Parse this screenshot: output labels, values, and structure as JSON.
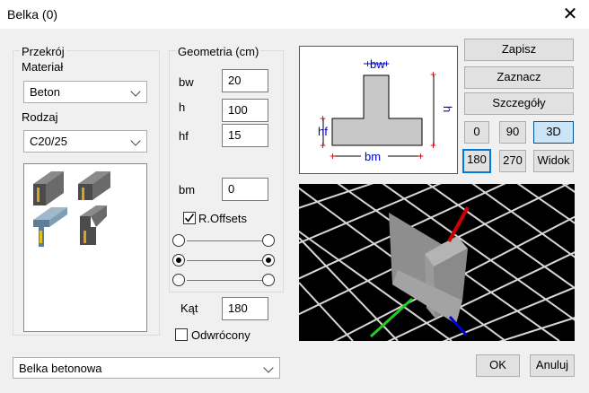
{
  "window": {
    "title": "Belka (0)",
    "close_icon": "close-icon"
  },
  "section": {
    "przekroj_label": "Przekrój",
    "material_label": "Materiał",
    "material_value": "Beton",
    "rodzaj_label": "Rodzaj",
    "rodzaj_value": "C20/25"
  },
  "geometry": {
    "group_label": "Geometria (cm)",
    "fields": [
      {
        "label": "bw",
        "value": "20"
      },
      {
        "label": "h",
        "value": "100"
      },
      {
        "label": "hf",
        "value": "15"
      },
      {
        "label": "bm",
        "value": "0"
      }
    ],
    "offsets_label": "R.Offsets",
    "offsets_checked": true,
    "offset_rows_selected": [
      false,
      true,
      false
    ],
    "kat_label": "Kąt",
    "kat_value": "180",
    "odwrocony_label": "Odwrócony",
    "odwrocony_checked": false
  },
  "diagram": {
    "labels": {
      "bw": "bw",
      "h": "h",
      "hf": "hf",
      "bm": "bm"
    }
  },
  "actions": {
    "save": "Zapisz",
    "select": "Zaznacz",
    "details": "Szczegóły",
    "view_buttons": [
      "0",
      "90",
      "3D",
      "180",
      "270",
      "Widok"
    ],
    "active_view": "3D"
  },
  "footer": {
    "type_value": "Belka betonowa",
    "ok": "OK",
    "cancel": "Anuluj"
  },
  "colors": {
    "accent": "#0078d7",
    "diagram_line": "#0000cc",
    "dim_red": "#cc0000"
  }
}
